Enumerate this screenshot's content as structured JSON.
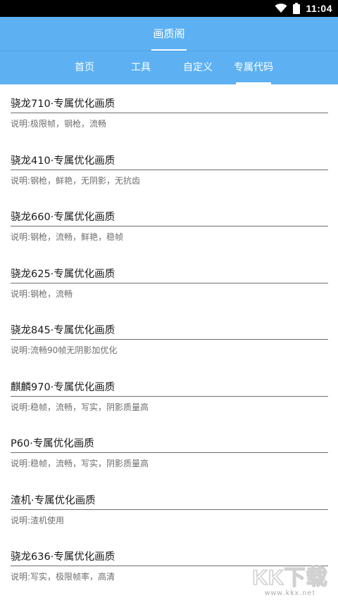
{
  "status_bar": {
    "time": "11:04",
    "icons": [
      "wifi-icon",
      "battery-icon"
    ]
  },
  "app": {
    "title": "画质阁"
  },
  "tabs": [
    {
      "label": "首页",
      "active": false
    },
    {
      "label": "工具",
      "active": false
    },
    {
      "label": "自定义",
      "active": false
    },
    {
      "label": "专属代码",
      "active": true
    }
  ],
  "items": [
    {
      "title": "骁龙710·专属优化画质",
      "desc": "说明:极限帧，钢枪，流畅"
    },
    {
      "title": "骁龙410·专属优化画质",
      "desc": "说明:钢枪，鲜艳，无阴影，无抗齿"
    },
    {
      "title": "骁龙660·专属优化画质",
      "desc": "说明:钢枪，流畅，鲜艳，稳帧"
    },
    {
      "title": "骁龙625·专属优化画质",
      "desc": "说明:钢枪，流畅"
    },
    {
      "title": "骁龙845·专属优化画质",
      "desc": "说明:流畅90帧无阴影加优化"
    },
    {
      "title": "麒麟970·专属优化画质",
      "desc": "说明:稳帧，流畅，写实，阴影质量高"
    },
    {
      "title": "P60·专属优化画质",
      "desc": "说明:稳帧，流畅，写实，阴影质量高"
    },
    {
      "title": "渣机·专属优化画质",
      "desc": "说明:渣机使用"
    },
    {
      "title": "骁龙636·专属优化画质",
      "desc": "说明:写实，极限帧率，高清"
    }
  ],
  "watermark": {
    "text": "KK下载",
    "url": "www.kkx.net"
  },
  "colors": {
    "primary": "#5db1f3",
    "status_bar": "#000000",
    "title_text": "#1a1a1a",
    "desc_text": "#6e6e6e",
    "divider": "#6f6f6f"
  }
}
